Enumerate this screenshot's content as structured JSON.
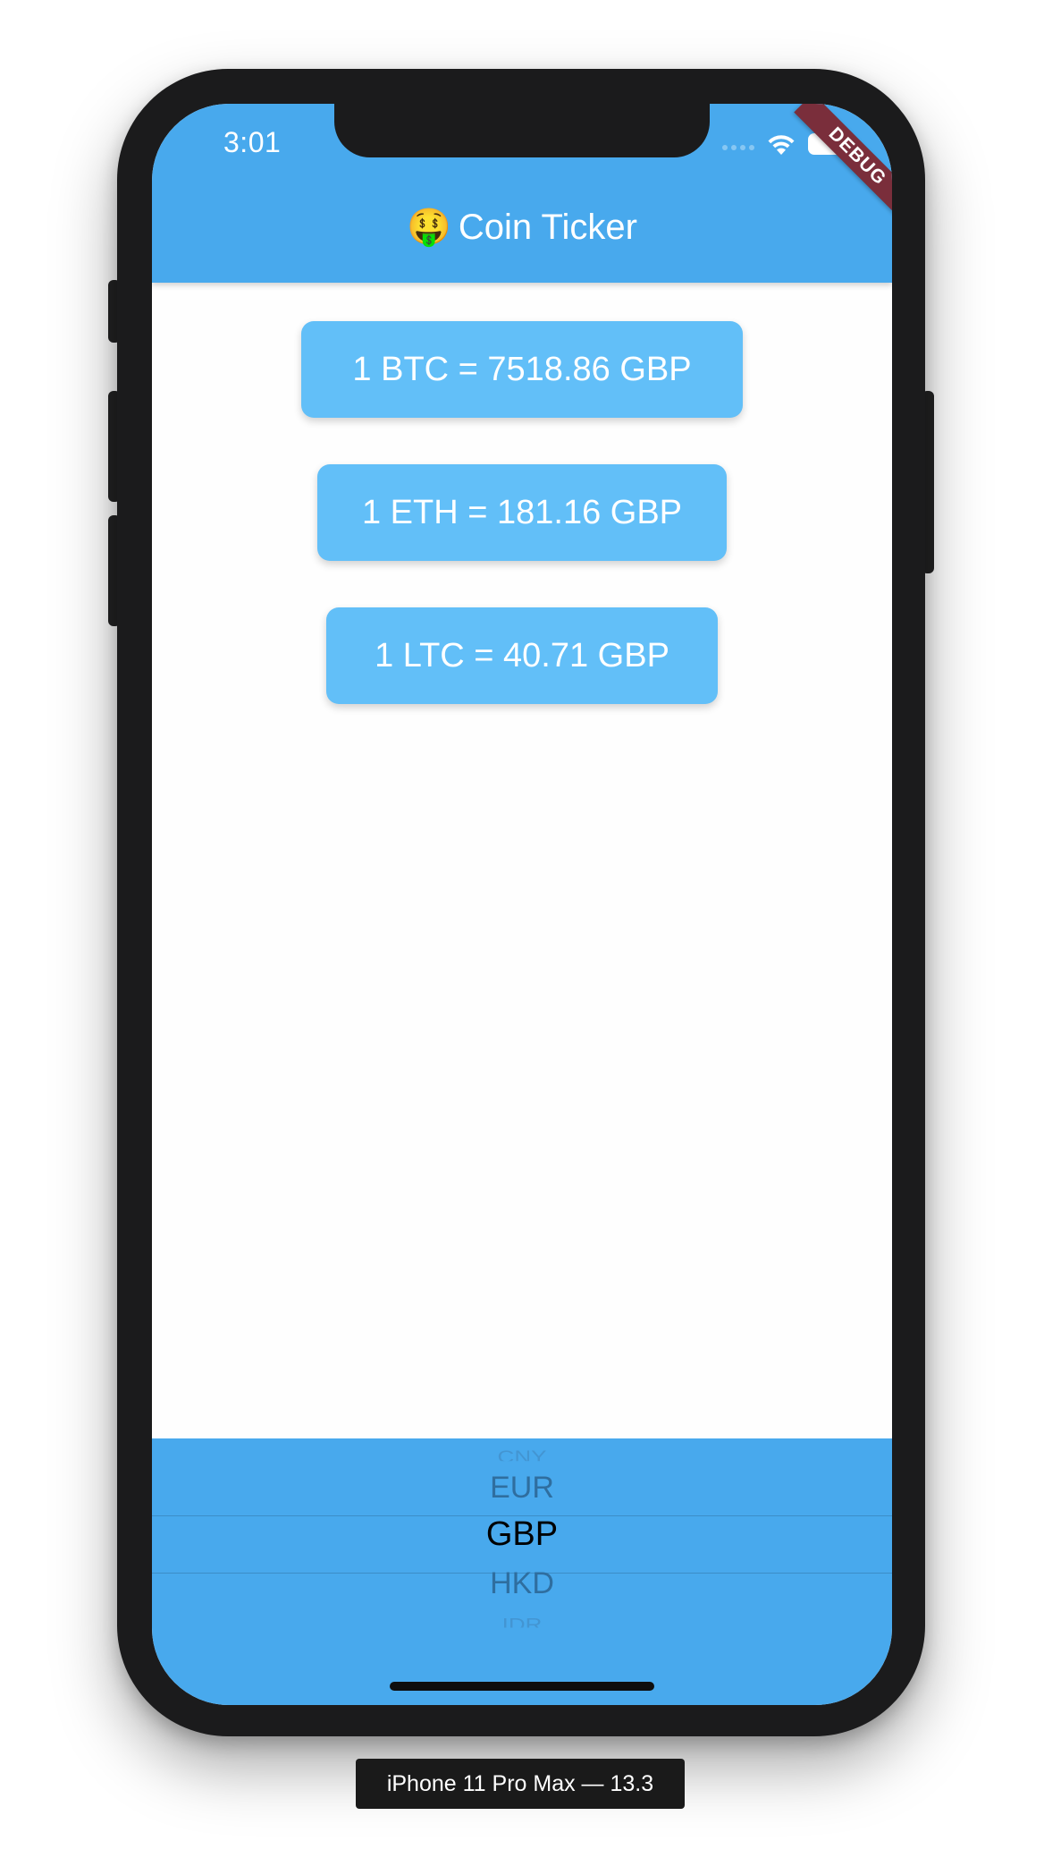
{
  "status_bar": {
    "time": "3:01",
    "icons": [
      "signal-icon",
      "wifi-icon",
      "battery-icon"
    ]
  },
  "debug_banner": "DEBUG",
  "app_bar": {
    "emoji": "🤑",
    "emoji_icon": "money-mouth-face-icon",
    "title": "Coin Ticker",
    "color": "#48a9ed"
  },
  "rates": {
    "btc": "1 BTC = 7518.86 GBP",
    "eth": "1 ETH = 181.16 GBP",
    "ltc": "1 LTC = 40.71 GBP",
    "card_color": "#62bff8"
  },
  "picker": {
    "items": [
      "CNY",
      "EUR",
      "GBP",
      "HKD",
      "IDR"
    ],
    "selected": "GBP"
  },
  "simulator": {
    "label": "iPhone 11 Pro Max — 13.3"
  }
}
